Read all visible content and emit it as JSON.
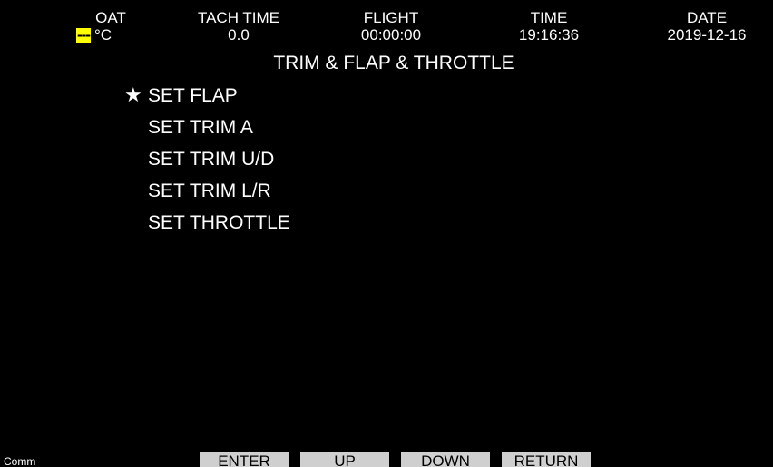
{
  "header": {
    "oat": {
      "label": "OAT",
      "value": "---",
      "unit": "°C",
      "value_bg": "#ffff00"
    },
    "tach_time": {
      "label": "TACH TIME",
      "value": "0.0"
    },
    "flight": {
      "label": "FLIGHT",
      "value": "00:00:00"
    },
    "time": {
      "label": "TIME",
      "value": "19:16:36"
    },
    "date": {
      "label": "DATE",
      "value": "2019-12-16"
    }
  },
  "title": "TRIM & FLAP & THROTTLE",
  "menu": {
    "selected_marker": "★",
    "selected_index": 0,
    "items": [
      {
        "label": "SET FLAP"
      },
      {
        "label": "SET TRIM A"
      },
      {
        "label": "SET TRIM U/D"
      },
      {
        "label": "SET TRIM L/R"
      },
      {
        "label": "SET THROTTLE"
      }
    ]
  },
  "footer": {
    "comm_label": "Comm",
    "softkeys": {
      "enter": "ENTER",
      "up": "UP",
      "down": "DOWN",
      "return": "RETURN"
    }
  },
  "colors": {
    "background": "#000000",
    "text": "#ffffff",
    "highlight": "#ffff00",
    "softkey_bg": "#cfcfcf",
    "softkey_text": "#000000"
  }
}
